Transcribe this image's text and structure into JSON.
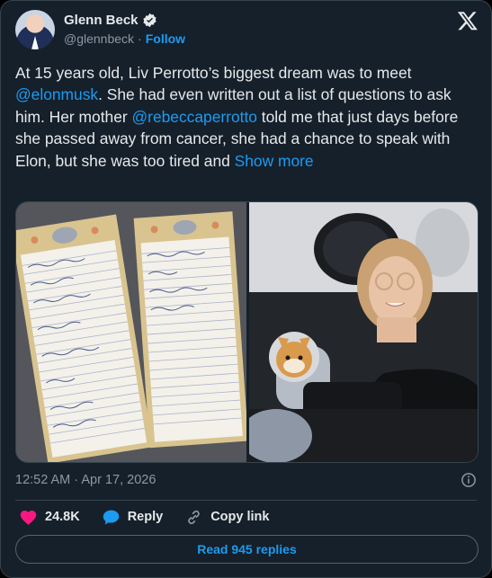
{
  "author": {
    "name": "Glenn Beck",
    "handle": "@glennbeck",
    "separator": "·",
    "follow_label": "Follow"
  },
  "tweet": {
    "text_1": "At 15 years old, Liv Perrotto’s biggest dream was to meet ",
    "mention_1": "@elonmusk",
    "text_2": ". She had even written out a list of questions to ask him. Her mother ",
    "mention_2": "@rebeccaperrotto",
    "text_3": " told me that just days before she passed away from cancer, she had a chance to speak with Elon, but she was too tired and ",
    "show_more": "Show more"
  },
  "timestamp": "12:52 AM · Apr 17, 2026",
  "actions": {
    "likes": "24.8K",
    "reply_label": "Reply",
    "copy_link_label": "Copy link"
  },
  "replies_button": "Read 945 replies",
  "icons": {
    "verified": "verified-badge-icon",
    "logo": "x-logo-icon",
    "info": "info-icon",
    "like": "heart-icon",
    "reply": "speech-bubble-icon",
    "link": "link-icon"
  },
  "colors": {
    "background": "#15202b",
    "accent": "#1d9bf0",
    "like": "#f91880",
    "muted": "#8b98a5",
    "text": "#e7e9ea"
  }
}
